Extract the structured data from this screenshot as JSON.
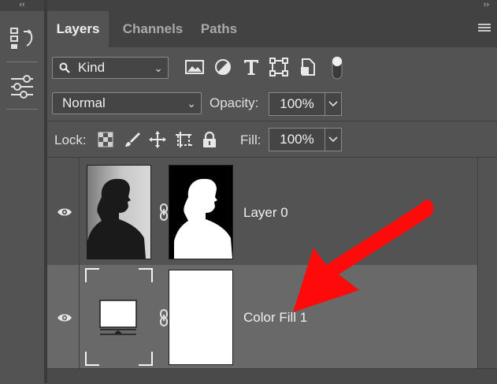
{
  "panel": {
    "tabs": [
      {
        "label": "Layers",
        "active": true
      },
      {
        "label": "Channels",
        "active": false
      },
      {
        "label": "Paths",
        "active": false
      }
    ]
  },
  "filter": {
    "kind_label": "Kind",
    "icons": [
      "image-filter-icon",
      "adjustment-filter-icon",
      "type-filter-icon",
      "shape-filter-icon",
      "smart-object-filter-icon",
      "filter-toggle-icon"
    ]
  },
  "blend": {
    "mode": "Normal",
    "opacity_label": "Opacity:",
    "opacity_value": "100%"
  },
  "lock": {
    "label": "Lock:",
    "fill_label": "Fill:",
    "fill_value": "100%",
    "icons": [
      "lock-transparent-icon",
      "lock-image-icon",
      "lock-position-icon",
      "lock-artboard-icon",
      "lock-all-icon"
    ]
  },
  "layers": [
    {
      "name": "Layer 0",
      "visible": true,
      "selected": false
    },
    {
      "name": "Color Fill 1",
      "visible": true,
      "selected": true
    }
  ],
  "colors": {
    "panel_bg": "#535353",
    "selected_row": "#696969",
    "annotation_arrow": "#ff0000"
  }
}
